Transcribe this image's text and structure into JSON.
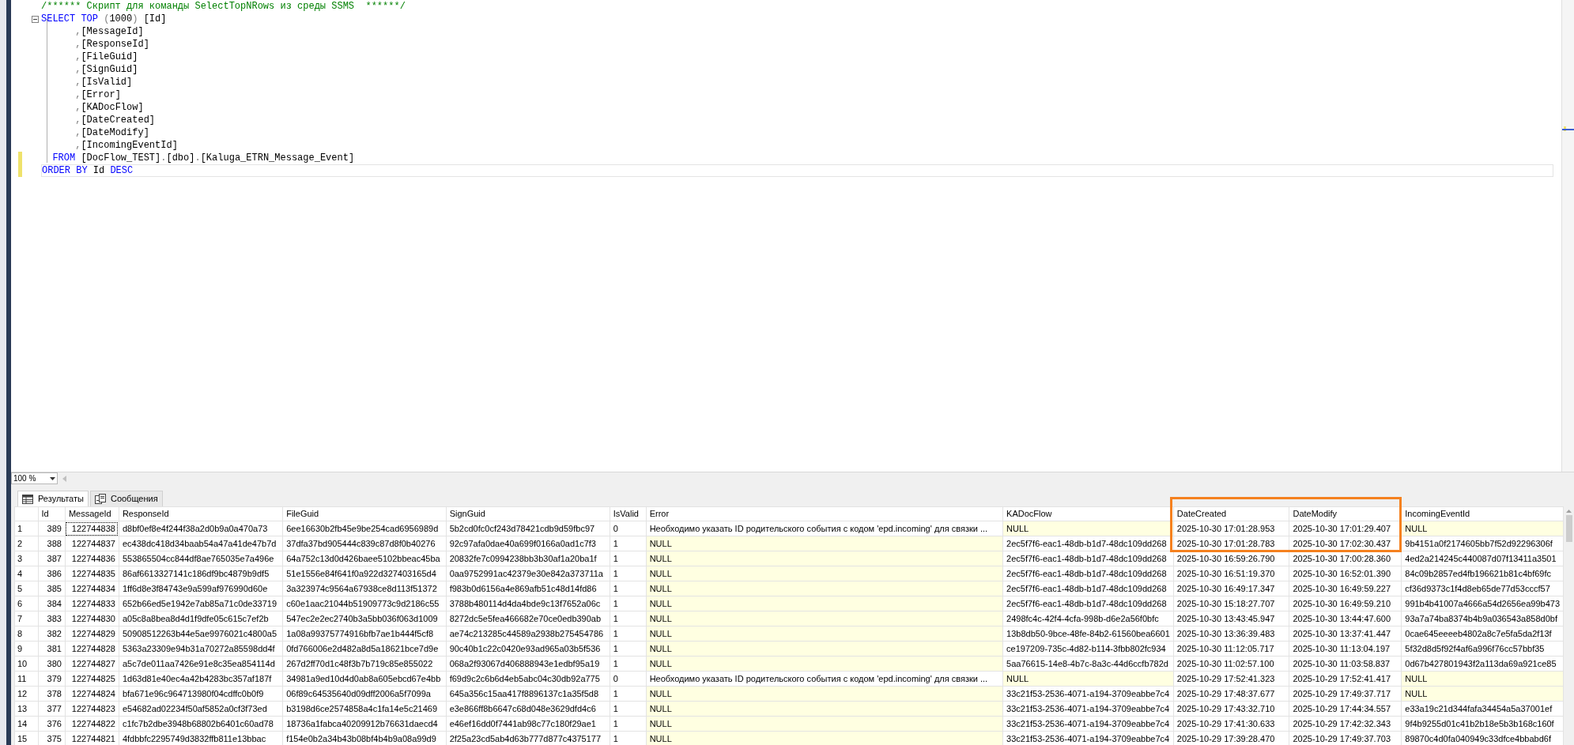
{
  "editor": {
    "lines": [
      {
        "changed": false,
        "current": false,
        "foldable": false,
        "tokens": [
          {
            "kind": "comment",
            "text": "/****** Скрипт для команды SelectTopNRows из среды SSMS  ******/"
          }
        ]
      },
      {
        "changed": false,
        "current": false,
        "foldable": true,
        "tokens": [
          {
            "kind": "keyword",
            "text": "SELECT TOP"
          },
          {
            "kind": "punct",
            "text": " ("
          },
          {
            "kind": "plain",
            "text": "1000"
          },
          {
            "kind": "punct",
            "text": ")"
          },
          {
            "kind": "plain",
            "text": " [Id]"
          }
        ]
      },
      {
        "changed": false,
        "current": false,
        "foldable": false,
        "tokens": [
          {
            "kind": "punct",
            "text": ","
          },
          {
            "kind": "plain",
            "text": "[MessageId]"
          }
        ]
      },
      {
        "changed": false,
        "current": false,
        "foldable": false,
        "tokens": [
          {
            "kind": "punct",
            "text": ","
          },
          {
            "kind": "plain",
            "text": "[ResponseId]"
          }
        ]
      },
      {
        "changed": false,
        "current": false,
        "foldable": false,
        "tokens": [
          {
            "kind": "punct",
            "text": ","
          },
          {
            "kind": "plain",
            "text": "[FileGuid]"
          }
        ]
      },
      {
        "changed": false,
        "current": false,
        "foldable": false,
        "tokens": [
          {
            "kind": "punct",
            "text": ","
          },
          {
            "kind": "plain",
            "text": "[SignGuid]"
          }
        ]
      },
      {
        "changed": false,
        "current": false,
        "foldable": false,
        "tokens": [
          {
            "kind": "punct",
            "text": ","
          },
          {
            "kind": "plain",
            "text": "[IsValid]"
          }
        ]
      },
      {
        "changed": false,
        "current": false,
        "foldable": false,
        "tokens": [
          {
            "kind": "punct",
            "text": ","
          },
          {
            "kind": "plain",
            "text": "[Error]"
          }
        ]
      },
      {
        "changed": false,
        "current": false,
        "foldable": false,
        "tokens": [
          {
            "kind": "punct",
            "text": ","
          },
          {
            "kind": "plain",
            "text": "[KADocFlow]"
          }
        ]
      },
      {
        "changed": false,
        "current": false,
        "foldable": false,
        "tokens": [
          {
            "kind": "punct",
            "text": ","
          },
          {
            "kind": "plain",
            "text": "[DateCreated]"
          }
        ]
      },
      {
        "changed": false,
        "current": false,
        "foldable": false,
        "tokens": [
          {
            "kind": "punct",
            "text": ","
          },
          {
            "kind": "plain",
            "text": "[DateModify]"
          }
        ]
      },
      {
        "changed": false,
        "current": false,
        "foldable": false,
        "tokens": [
          {
            "kind": "punct",
            "text": ","
          },
          {
            "kind": "plain",
            "text": "[IncomingEventId]"
          }
        ]
      },
      {
        "changed": true,
        "current": false,
        "foldable": false,
        "tokens": [
          {
            "kind": "keyword",
            "text": "  FROM"
          },
          {
            "kind": "plain",
            "text": " [DocFlow_TEST]"
          },
          {
            "kind": "punct",
            "text": "."
          },
          {
            "kind": "plain",
            "text": "[dbo]"
          },
          {
            "kind": "punct",
            "text": "."
          },
          {
            "kind": "plain",
            "text": "[Kaluga_ETRN_Message_Event]"
          }
        ]
      },
      {
        "changed": true,
        "current": true,
        "foldable": false,
        "tokens": [
          {
            "kind": "keyword",
            "text": "ORDER BY"
          },
          {
            "kind": "plain",
            "text": " Id "
          },
          {
            "kind": "keyword",
            "text": "DESC"
          }
        ]
      }
    ]
  },
  "zoom": {
    "value": "100 %"
  },
  "tabs": [
    {
      "label": "Результаты",
      "selected": true,
      "kind": "grid"
    },
    {
      "label": "Сообщения",
      "selected": false,
      "kind": "messages"
    }
  ],
  "highlight": {
    "visible": true
  },
  "table": {
    "columns": [
      "Id",
      "MessageId",
      "ResponseId",
      "FileGuid",
      "SignGuid",
      "IsValid",
      "Error",
      "KADocFlow",
      "DateCreated",
      "DateModify",
      "IncomingEventId"
    ],
    "rows": [
      {
        "number": "1",
        "cells": [
          "389",
          {
            "value": "122744838",
            "focused": true
          },
          "d8bf0ef8e4f244f38a2d0b9a0a470a73",
          "6ee16630b2fb45e9be254cad6956989d",
          "5b2cd0fc0cf243d78421cdb9d59fbc97",
          "0",
          "Необходимо указать ID родительского события с кодом 'epd.incoming' для связки ...",
          {
            "value": "NULL",
            "null": true
          },
          "2025-10-30 17:01:28.953",
          "2025-10-30 17:01:29.407",
          {
            "value": "NULL",
            "null": true
          }
        ]
      },
      {
        "number": "2",
        "cells": [
          "388",
          "122744837",
          "ec438dc418d34baab54a47a41de47b7d",
          "37dfa37bd905444c839c87d8f0b40276",
          "92c97afa0dae40a699f0166a0ad1c7f3",
          "1",
          {
            "value": "NULL",
            "null": true
          },
          "2ec5f7f6-eac1-48db-b1d7-48dc109dd268",
          "2025-10-30 17:01:28.783",
          "2025-10-30 17:02:30.437",
          "9b4151a0f2174605bb7f52d92296306f"
        ]
      },
      {
        "number": "3",
        "cells": [
          "387",
          "122744836",
          "553865504cc844df8ae765035e7a496e",
          "64a752c13d0d426baee5102bbeac45ba",
          "20832fe7c0994238bb3b30af1a20ba1f",
          "1",
          {
            "value": "NULL",
            "null": true
          },
          "2ec5f7f6-eac1-48db-b1d7-48dc109dd268",
          "2025-10-30 16:59:26.790",
          "2025-10-30 17:00:28.360",
          "4ed2a214245c440087d07f13411a3501"
        ]
      },
      {
        "number": "4",
        "cells": [
          "386",
          "122744835",
          "86af6613327141c186df9bc4879b9df5",
          "51e1556e84f641f0a922d327403165d4",
          "0aa9752991ac42379e30e842a373711a",
          "1",
          {
            "value": "NULL",
            "null": true
          },
          "2ec5f7f6-eac1-48db-b1d7-48dc109dd268",
          "2025-10-30 16:51:19.370",
          "2025-10-30 16:52:01.390",
          "84c09b2857ed4fb196621b81c4bf69fc"
        ]
      },
      {
        "number": "5",
        "cells": [
          "385",
          "122744834",
          "1ff6d8e3f84743e9a599af976990d60e",
          "3a323974c9564a67938ce8d113f51372",
          "f983b0d6156a4e869afb51c48d14fd86",
          "1",
          {
            "value": "NULL",
            "null": true
          },
          "2ec5f7f6-eac1-48db-b1d7-48dc109dd268",
          "2025-10-30 16:49:17.347",
          "2025-10-30 16:49:59.227",
          "cf36d9373c1f4d8eb65de77d53cccf57"
        ]
      },
      {
        "number": "6",
        "cells": [
          "384",
          "122744833",
          "652b66ed5e1942e7ab85a71c0de33719",
          "c60e1aac21044b51909773c9d2186c55",
          "3788b480114d4da4bde9c13f7652a06c",
          "1",
          {
            "value": "NULL",
            "null": true
          },
          "2ec5f7f6-eac1-48db-b1d7-48dc109dd268",
          "2025-10-30 15:18:27.707",
          "2025-10-30 16:49:59.210",
          "991b4b41007a4666a54d2656ea99b473"
        ]
      },
      {
        "number": "7",
        "cells": [
          "383",
          "122744830",
          "a05c8a8bea8d4d1f9dfe05c615c7ef2b",
          "547ec2e2ec2740b3a5bb036f063d1009",
          "8272dc5e5fea466682e70ce0edb390ab",
          "1",
          {
            "value": "NULL",
            "null": true
          },
          "2498fc4c-42f4-4cfa-998b-d6e2a56f0bfc",
          "2025-10-30 13:43:45.947",
          "2025-10-30 13:44:47.600",
          "93a7a74ba8374b4b9a036543a858d0bf"
        ]
      },
      {
        "number": "8",
        "cells": [
          "382",
          "122744829",
          "50908512263b44e5ae9976021c4800a5",
          "1a08a99375774916bfb7ae1b444f5cf8",
          "ae74c213285c44589a2938b275454786",
          "1",
          {
            "value": "NULL",
            "null": true
          },
          "13b8db50-9bce-48fe-84b2-61560bea6601",
          "2025-10-30 13:36:39.483",
          "2025-10-30 13:37:41.447",
          "0cae645eeeeb4802a8c7e5fa5da2f13f"
        ]
      },
      {
        "number": "9",
        "cells": [
          "381",
          "122744828",
          "5363a23309e94b31a70272a85598dd4f",
          "0fd766006e2d482a8d5a18621bce7d9e",
          "90c40b1c22c0420e93ad965a03b5f536",
          "1",
          {
            "value": "NULL",
            "null": true
          },
          "ce197209-735c-4d82-b114-3fbb802fc934",
          "2025-10-30 11:12:05.717",
          "2025-10-30 11:13:04.197",
          "5f32d8d5f92f4af6a996f76cc57bbf35"
        ]
      },
      {
        "number": "10",
        "cells": [
          "380",
          "122744827",
          "a5c7de011aa7426e91e8c35ea854114d",
          "267d2ff70d1c48f3b7b719c85e855022",
          "068a2f93067d406888943e1edbf95a19",
          "1",
          {
            "value": "NULL",
            "null": true
          },
          "5aa76615-14e8-4b7c-8a3c-44d6ccfb782d",
          "2025-10-30 11:02:57.100",
          "2025-10-30 11:03:58.837",
          "0d67b427801943f2a113da69a921ce85"
        ]
      },
      {
        "number": "11",
        "cells": [
          "379",
          "122744825",
          "1d63d81e40ec4a42b4283bc357af187f",
          "34981a9ed10d4d0ab8a605ebcd67e4bb",
          "f69d9c2c6b6d4eb5abc04c30db92a775",
          "0",
          "Необходимо указать ID родительского события с кодом 'epd.incoming' для связки ...",
          {
            "value": "NULL",
            "null": true
          },
          "2025-10-29 17:52:41.323",
          "2025-10-29 17:52:41.417",
          {
            "value": "NULL",
            "null": true
          }
        ]
      },
      {
        "number": "12",
        "cells": [
          "378",
          "122744824",
          "bfa671e96c964713980f04cdffc0b0f9",
          "06f89c64535640d09dff2006a5f7099a",
          "645a356c15aa417f8896137c1a35f5d8",
          "1",
          {
            "value": "NULL",
            "null": true
          },
          "33c21f53-2536-4071-a194-3709eabbe7c4",
          "2025-10-29 17:48:37.677",
          "2025-10-29 17:49:37.717",
          {
            "value": "NULL",
            "null": true
          }
        ]
      },
      {
        "number": "13",
        "cells": [
          "377",
          "122744823",
          "e54682ad02234f50af5852a0cf3f73ed",
          "b3198d6ce2574858a4c1fa14e5c21469",
          "e3e866ff8b6647c68d048e3629dfd4c6",
          "1",
          {
            "value": "NULL",
            "null": true
          },
          "33c21f53-2536-4071-a194-3709eabbe7c4",
          "2025-10-29 17:43:32.710",
          "2025-10-29 17:44:34.557",
          "e33a19c21d344fafa34454a5a37001ef"
        ]
      },
      {
        "number": "14",
        "cells": [
          "376",
          "122744822",
          "c1fc7b2dbe3948b68802b6401c60ad78",
          "18736a1fabca40209912b76631daecd4",
          "e46ef16dd0f7441ab98c77c180f29ae1",
          "1",
          {
            "value": "NULL",
            "null": true
          },
          "33c21f53-2536-4071-a194-3709eabbe7c4",
          "2025-10-29 17:41:30.633",
          "2025-10-29 17:42:32.343",
          "9f4b9255d01c41b2b18e5b3b168c160f"
        ]
      },
      {
        "number": "15",
        "cells": [
          "375",
          "122744821",
          "4fdbbfc2295749d3832ffb811e13bbac",
          "f154e0b2a34b43b08bf4b4b9a08a99d9",
          "2f25a23cd5ab4d63b777d877c4375177",
          "1",
          {
            "value": "NULL",
            "null": true
          },
          "33c21f53-2536-4071-a194-3709eabbe7c4",
          "2025-10-29 17:39:28.470",
          "2025-10-29 17:49:37.703",
          "89870c4d0fa040949c33dfce4bbabd6f"
        ]
      }
    ]
  }
}
